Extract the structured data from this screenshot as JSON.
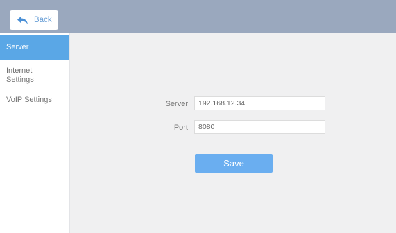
{
  "header": {
    "back_label": "Back",
    "back_icon": "back-arrow-icon"
  },
  "sidebar": {
    "items": [
      {
        "label": "Server",
        "active": true
      },
      {
        "label": "Internet\nSettings",
        "active": false
      },
      {
        "label": "VoIP Settings",
        "active": false
      }
    ]
  },
  "form": {
    "server": {
      "label": "Server",
      "value": "192.168.12.34"
    },
    "port": {
      "label": "Port",
      "value": "8080"
    },
    "save_label": "Save"
  },
  "colors": {
    "header_bg": "#9aa8be",
    "accent": "#5aa7e6",
    "button": "#6aaef0",
    "page_bg": "#f0f0f1"
  }
}
